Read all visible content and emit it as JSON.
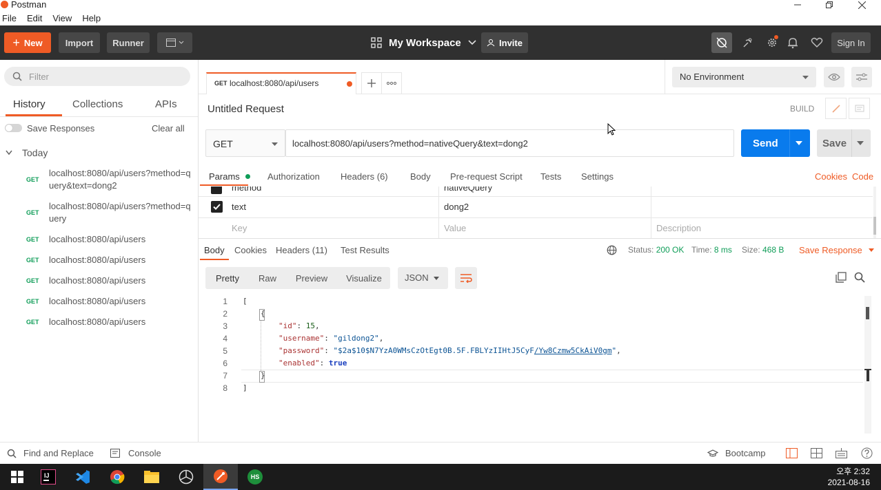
{
  "window": {
    "title": "Postman"
  },
  "menu": [
    "File",
    "Edit",
    "View",
    "Help"
  ],
  "header": {
    "new_label": "New",
    "import_label": "Import",
    "runner_label": "Runner",
    "workspace_label": "My Workspace",
    "invite_label": "Invite",
    "signin_label": "Sign In"
  },
  "sidebar": {
    "filter_placeholder": "Filter",
    "tabs": [
      "History",
      "Collections",
      "APIs"
    ],
    "save_responses_label": "Save Responses",
    "clear_all_label": "Clear all",
    "group_label": "Today",
    "items": [
      {
        "method": "GET",
        "url": "localhost:8080/api/users?method=query&text=dong2"
      },
      {
        "method": "GET",
        "url": "localhost:8080/api/users?method=query"
      },
      {
        "method": "GET",
        "url": "localhost:8080/api/users"
      },
      {
        "method": "GET",
        "url": "localhost:8080/api/users"
      },
      {
        "method": "GET",
        "url": "localhost:8080/api/users"
      },
      {
        "method": "GET",
        "url": "localhost:8080/api/users"
      },
      {
        "method": "GET",
        "url": "localhost:8080/api/users"
      }
    ]
  },
  "request": {
    "tab_method": "GET",
    "tab_url": "localhost:8080/api/users",
    "environment": "No Environment",
    "name": "Untitled Request",
    "build_label": "BUILD",
    "method": "GET",
    "url": "localhost:8080/api/users?method=nativeQuery&text=dong2",
    "send_label": "Send",
    "save_label": "Save",
    "tabs": [
      "Params",
      "Authorization",
      "Headers (6)",
      "Body",
      "Pre-request Script",
      "Tests",
      "Settings"
    ],
    "cookies_label": "Cookies",
    "code_label": "Code",
    "params": {
      "cut_row_key": "method",
      "cut_row_value": "nativeQuery",
      "row_key": "text",
      "row_value": "dong2",
      "key_placeholder": "Key",
      "value_placeholder": "Value",
      "description_placeholder": "Description"
    }
  },
  "response": {
    "tabs": [
      "Body",
      "Cookies",
      "Headers (11)",
      "Test Results"
    ],
    "status_label": "Status:",
    "status_value": "200 OK",
    "time_label": "Time:",
    "time_value": "8 ms",
    "size_label": "Size:",
    "size_value": "468 B",
    "save_response_label": "Save Response",
    "view_modes": [
      "Pretty",
      "Raw",
      "Preview",
      "Visualize"
    ],
    "format": "JSON",
    "code_lines": [
      "1",
      "2",
      "3",
      "4",
      "5",
      "6",
      "7",
      "8"
    ],
    "json": {
      "open_bracket": "[",
      "open_brace": "{",
      "id_key": "\"id\"",
      "id_value": "15",
      "username_key": "\"username\"",
      "username_value": "\"gildong2\"",
      "password_key": "\"password\"",
      "password_value_a": "\"$2a$10$N7YzA0WMsCzOtEgt0B.5F.FBLYzIIHtJ5CyF",
      "password_value_b": "/Yw8Czmw5CkAiV0gm",
      "password_value_c": "\"",
      "enabled_key": "\"enabled\"",
      "enabled_value": "true",
      "close_brace": "}",
      "close_bracket": "]"
    }
  },
  "statusbar": {
    "find_replace_label": "Find and Replace",
    "console_label": "Console",
    "bootcamp_label": "Bootcamp"
  },
  "taskbar": {
    "time": "오후 2:32",
    "date": "2021-08-16",
    "hs_label": "HS"
  },
  "colors": {
    "accent": "#ef5b25",
    "header_bg": "#303030",
    "send_blue": "#097bed",
    "get_green": "#0f9d58"
  }
}
